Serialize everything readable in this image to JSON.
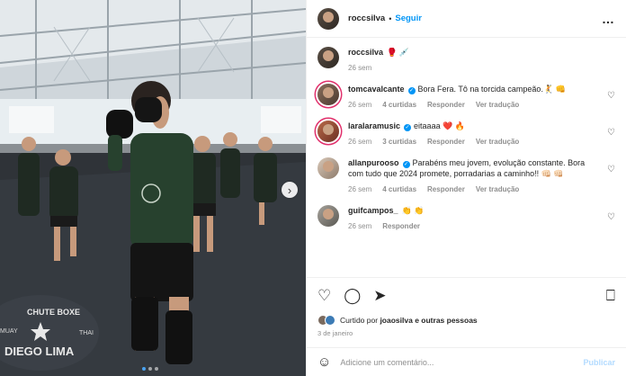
{
  "post": {
    "username": "roccsilva",
    "separator": "•",
    "follow_label": "Seguir",
    "more_label": "…"
  },
  "photo": {
    "banner_line1": "CHUTE BOXE",
    "banner_line2": "DIEGO LIMA",
    "banner_left": "MUAY",
    "banner_right": "THAI",
    "next_icon": "›"
  },
  "caption": {
    "username": "roccsilva",
    "text": "🥊 💉",
    "time": "26 sem"
  },
  "comments": [
    {
      "username": "tomcavalcante",
      "verified": true,
      "text": "Bora Fera. Tô na torcida campeão.🤾 👊",
      "time": "26 sem",
      "likes": "4 curtidas",
      "reply": "Responder",
      "translate": "Ver tradução"
    },
    {
      "username": "laralaramusic",
      "verified": true,
      "text": "eitaaaa ❤️ 🔥",
      "time": "26 sem",
      "likes": "3 curtidas",
      "reply": "Responder",
      "translate": "Ver tradução"
    },
    {
      "username": "allanpurooso",
      "verified": true,
      "text": "Parabéns meu jovem, evolução constante. Bora com tudo que 2024 promete, porradarias a caminho!! 👊🏻 👊🏻",
      "time": "26 sem",
      "likes": "4 curtidas",
      "reply": "Responder",
      "translate": "Ver tradução"
    },
    {
      "username": "guifcampos_",
      "verified": false,
      "text": "👏 👏",
      "time": "26 sem",
      "likes": "",
      "reply": "Responder",
      "translate": ""
    }
  ],
  "actions": {
    "like_icon": "♡",
    "comment_icon": "◯",
    "share_icon": "➤",
    "save_icon": "⎕"
  },
  "liked_by": {
    "prefix": "Curtido por",
    "user": "joaosilva",
    "suffix": "e outras pessoas"
  },
  "date": "3 de janeiro",
  "add_comment": {
    "emoji_icon": "☺",
    "placeholder": "Adicione um comentário...",
    "publish_label": "Publicar"
  },
  "colors": {
    "accent": "#0095f6",
    "mat": "#2f3338",
    "shirt": "#27412e"
  }
}
